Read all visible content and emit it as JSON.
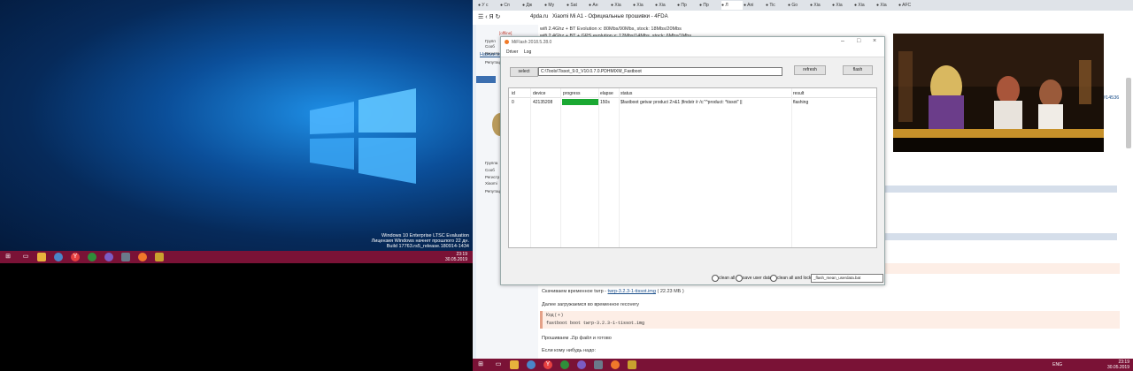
{
  "left_desktop": {
    "watermark": {
      "line1": "Windows 10 Enterprise LTSC Evaluation",
      "line2": "Лицензия Windows начнет прошлого 22 дн.",
      "line3": "Build 17763.rs5_release.180914-1434"
    },
    "taskbar": {
      "time": "23:19",
      "date": "30.05.2019"
    }
  },
  "browser": {
    "tabs": [
      {
        "label": "У с"
      },
      {
        "label": "Сп"
      },
      {
        "label": "Дж"
      },
      {
        "label": "Му"
      },
      {
        "label": "Sat"
      },
      {
        "label": "Ан"
      },
      {
        "label": "Xia"
      },
      {
        "label": "Xia"
      },
      {
        "label": "Xia"
      },
      {
        "label": "Пр"
      },
      {
        "label": "Пр"
      },
      {
        "label": "Л"
      },
      {
        "label": "Ani"
      },
      {
        "label": "Tic"
      },
      {
        "label": "Go"
      },
      {
        "label": "Xia"
      },
      {
        "label": "Xia"
      },
      {
        "label": "Xia"
      },
      {
        "label": "Xia"
      },
      {
        "label": "AFC"
      }
    ],
    "address": {
      "domain": "4pda.ru",
      "title": "Xiaomi Mi A1 - Официальные прошивки - 4FDA"
    },
    "page": {
      "line_wifi1": "wifi 2.4Ghz + BT Evolution x: 80Mbs/90Mbs, stock: 18Mbs/20Mbs",
      "line_wifi2": "wifi 2.4Ghz + BT + GPS evolution x: 12Mbs/14Mbs, stock: 6Mbs/1Mbs",
      "download_twrp_prefix": "Скачиваем временное twrp -",
      "download_twrp_link": "twrp-3.2.3-1-tissot.img",
      "download_twrp_size": "( 22.23 МБ )",
      "boot_recovery": "Далее загружаемся во временное recovery",
      "code_label": "Код ( + )",
      "code_text": "fastboot boot twrp-3.2.3-1-tissot.img",
      "flash_text": "Прошиваем .Zip файл и готово",
      "next_text": "Если кому нибудь надо:"
    },
    "sidebar_labels": [
      "Групп",
      "Сооб",
      "Регистр",
      "Репутаци",
      "Группа",
      "Сооб",
      "Регистр",
      "Xiaomi",
      "Репутац"
    ],
    "sidebar_link": "Нажмите здесь",
    "sidebar_badge": "[offline]",
    "post_ref": "#14536"
  },
  "miflash": {
    "title": "MiFlash 2018.5.28.0",
    "menu": [
      "Driver",
      "Log"
    ],
    "select_label": "select",
    "path": "C:\\Tools\\Tissot_9.0_V10.0.7.0.PDHMIXM_Fastboot",
    "refresh_label": "refresh",
    "flash_label": "flash",
    "columns": [
      "id",
      "device",
      "progress",
      "elapse",
      "status",
      "result"
    ],
    "rows": [
      {
        "id": "0",
        "device": "42135208",
        "progress": 1.0,
        "elapse": "150s",
        "status": "$fastboot getvar product   2>&1  |findstr /r /c:\"^product: *tissot\" ||",
        "result": "flashing"
      }
    ],
    "options": [
      "clean all",
      "save user data",
      "clean all and lock"
    ],
    "script": "_flash_mean_userdata.bat"
  },
  "right_taskbar": {
    "lang": "ENG",
    "time": "23:19",
    "date": "30.05.2019"
  }
}
